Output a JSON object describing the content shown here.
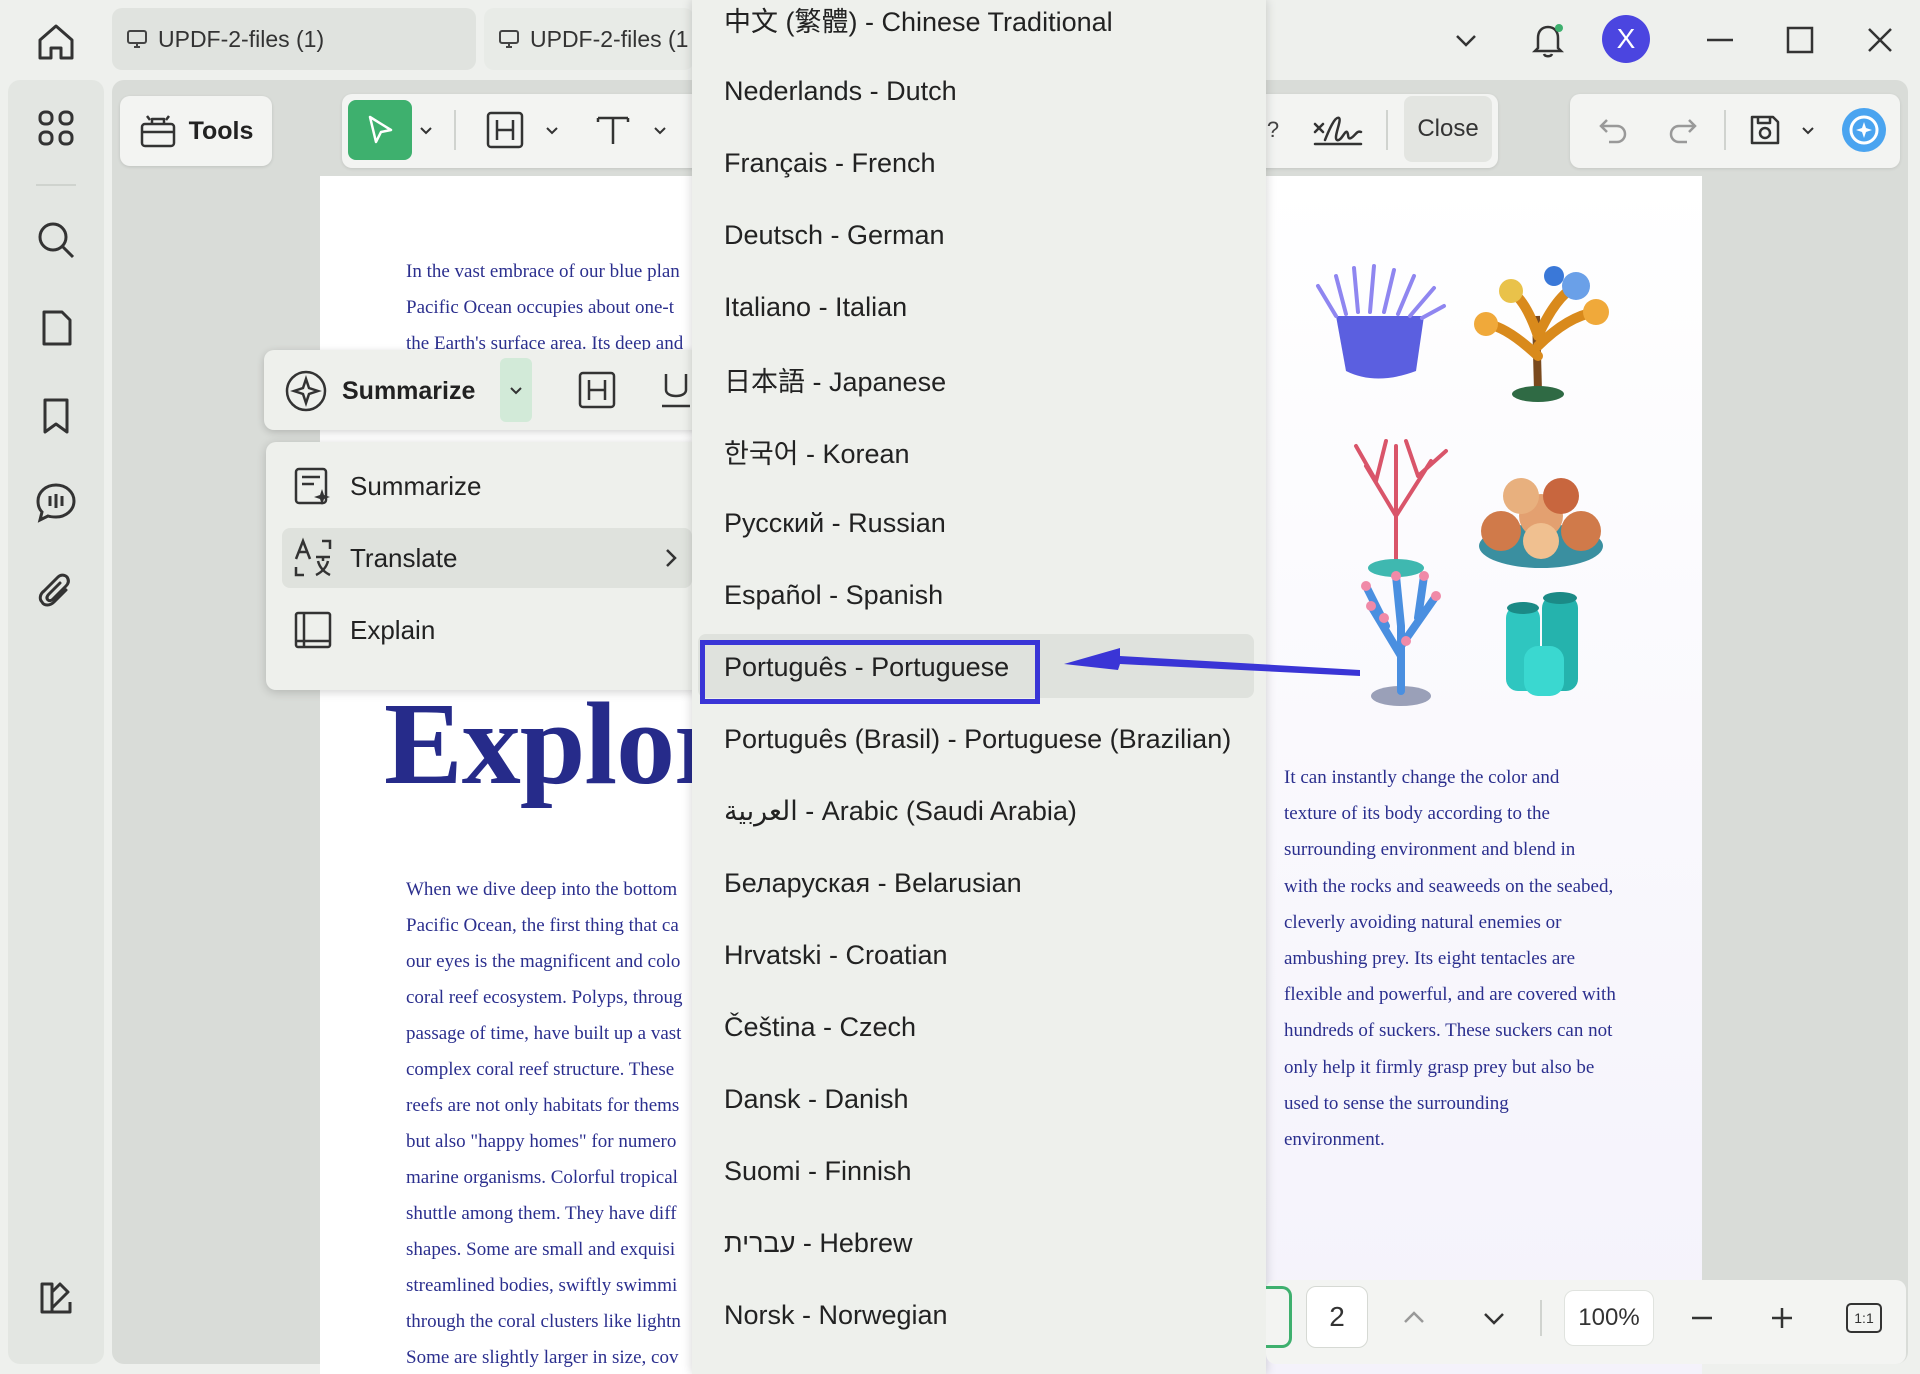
{
  "window": {
    "tabs": [
      {
        "label": "UPDF-2-files (1)"
      },
      {
        "label": "UPDF-2-files (1"
      }
    ],
    "avatar_letter": "X"
  },
  "toolbar": {
    "tools_label": "Tools",
    "close_label": "Close"
  },
  "document": {
    "left_intro": "In the vast embrace of our blue plan\nPacific Ocean occupies about one-t\nthe Earth's surface area. Its deep and",
    "left_title": "Explor",
    "left_body": "When we dive deep into the bottom\nPacific Ocean, the first thing that ca\nour eyes is the magnificent and colo\ncoral reef ecosystem. Polyps, throug\npassage of time, have built up a vast\ncomplex coral reef structure. These\nreefs are not only habitats for thems\nbut also \"happy homes\" for numero\nmarine organisms. Colorful tropical\nshuttle among them. They have diff\nshapes. Some are small and exquisi\nstreamlined bodies, swiftly swimmi\nthrough the coral clusters like lightn\nSome are slightly larger in size, cov",
    "right_body": "It can instantly change the color and\ntexture of its body according to the\nsurrounding environment and blend in\nwith the rocks and seaweeds on the seabed,\ncleverly avoiding natural enemies or\nambushing prey. Its eight tentacles are\nflexible and powerful, and are covered with\nhundreds of suckers. These suckers can not\nonly help it firmly grasp prey but also be\nused to sense the surrounding\nenvironment."
  },
  "ai_toolbar": {
    "summarize_label": "Summarize",
    "menu": [
      {
        "label": "Summarize",
        "icon": "summarize-icon"
      },
      {
        "label": "Translate",
        "icon": "translate-icon"
      },
      {
        "label": "Explain",
        "icon": "explain-icon"
      }
    ]
  },
  "languages": [
    "中文 (繁體) - Chinese Traditional",
    "Nederlands - Dutch",
    "Français - French",
    "Deutsch - German",
    "Italiano - Italian",
    "日本語 - Japanese",
    "한국어 - Korean",
    "Русский - Russian",
    "Español - Spanish",
    "Português - Portuguese",
    "Português (Brasil) - Portuguese (Brazilian)",
    "العربية - Arabic (Saudi Arabia)",
    "Беларуская - Belarusian",
    "Hrvatski - Croatian",
    "Čeština - Czech",
    "Dansk - Danish",
    "Suomi - Finnish",
    "עברית - Hebrew",
    "Norsk - Norwegian"
  ],
  "selected_language_index": 9,
  "pagination": {
    "page": "2",
    "zoom": "100%",
    "fit_label": "1:1"
  },
  "colors": {
    "accent_green": "#3eb06e",
    "highlight_blue": "#3a35d6",
    "avatar": "#4b45e0",
    "doc_text": "#2b2f8e"
  }
}
